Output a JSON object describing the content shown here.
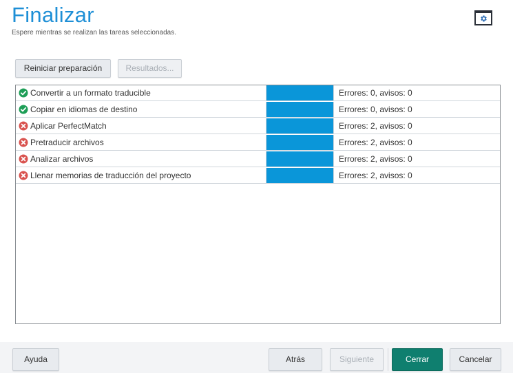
{
  "header": {
    "title": "Finalizar",
    "subtitle": "Espere mientras se realizan las tareas seleccionadas.",
    "settings_icon": "settings-window-icon"
  },
  "toolbar": {
    "restart_label": "Reiniciar preparación",
    "results_label": "Resultados..."
  },
  "tasks": [
    {
      "label": "Convertir a un formato traducible",
      "status": "success",
      "progress": 1.0,
      "result": "Errores: 0, avisos: 0"
    },
    {
      "label": "Copiar en idiomas de destino",
      "status": "success",
      "progress": 1.0,
      "result": "Errores: 0, avisos: 0"
    },
    {
      "label": "Aplicar PerfectMatch",
      "status": "error",
      "progress": 1.0,
      "result": "Errores: 2, avisos: 0"
    },
    {
      "label": "Pretraducir archivos",
      "status": "error",
      "progress": 1.0,
      "result": "Errores: 2, avisos: 0"
    },
    {
      "label": "Analizar archivos",
      "status": "error",
      "progress": 1.0,
      "result": "Errores: 2, avisos: 0"
    },
    {
      "label": "Llenar memorias de traducción del proyecto",
      "status": "error",
      "progress": 1.0,
      "result": "Errores: 2, avisos: 0"
    }
  ],
  "colors": {
    "success": "#1e9e57",
    "error": "#d9534f",
    "progress": "#0a96d9",
    "accent": "#1e8fd6",
    "primary_button": "#0f7f6f"
  },
  "footer": {
    "help_label": "Ayuda",
    "back_label": "Atrás",
    "next_label": "Siguiente",
    "close_label": "Cerrar",
    "cancel_label": "Cancelar"
  }
}
